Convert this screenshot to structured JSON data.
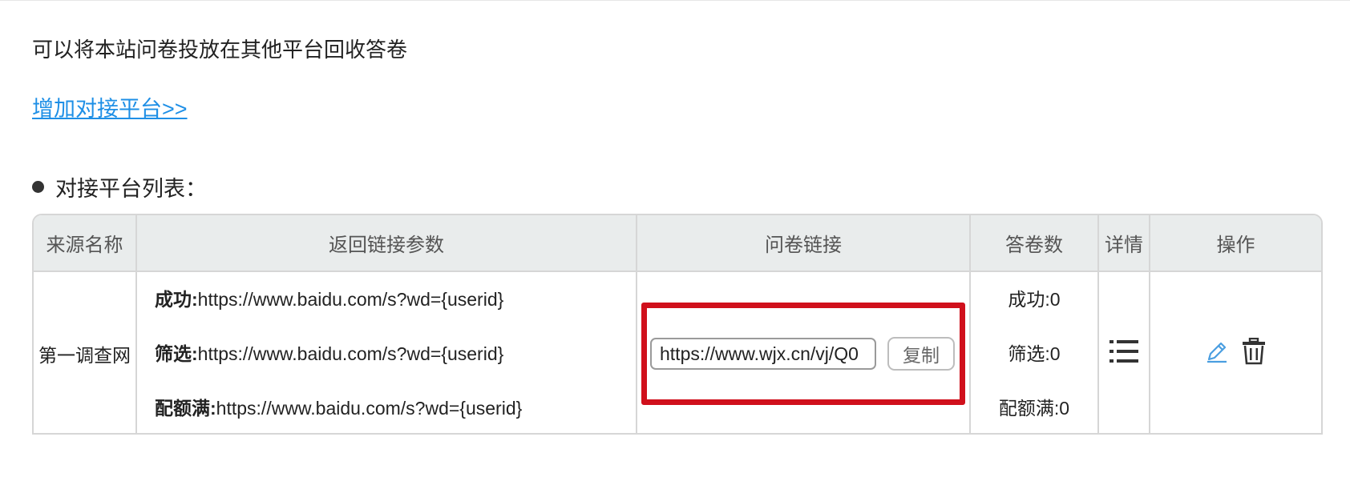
{
  "intro": "可以将本站问卷投放在其他平台回收答卷",
  "add_platform_link": "增加对接平台>>",
  "list_heading": "对接平台列表：",
  "table": {
    "headers": {
      "source_name": "来源名称",
      "return_params": "返回链接参数",
      "survey_link": "问卷链接",
      "answer_count": "答卷数",
      "details": "详情",
      "actions": "操作"
    },
    "rows": [
      {
        "source_name": "第一调查网",
        "params": [
          {
            "label": "成功:",
            "url": "https://www.baidu.com/s?wd={userid}"
          },
          {
            "label": "筛选:",
            "url": "https://www.baidu.com/s?wd={userid}"
          },
          {
            "label": "配额满:",
            "url": "https://www.baidu.com/s?wd={userid}"
          }
        ],
        "survey_link_value": "https://www.wjx.cn/vj/Q0",
        "copy_label": "复制",
        "counts": [
          "成功:0",
          "筛选:0",
          "配额满:0"
        ]
      }
    ]
  },
  "icons": {
    "details": "list-icon",
    "edit": "pencil-icon",
    "delete": "trash-icon"
  },
  "colors": {
    "link": "#1e8fe6",
    "highlight_box": "#d0101c",
    "header_bg": "#e9ecec",
    "edit_icon": "#4a9ee0"
  }
}
